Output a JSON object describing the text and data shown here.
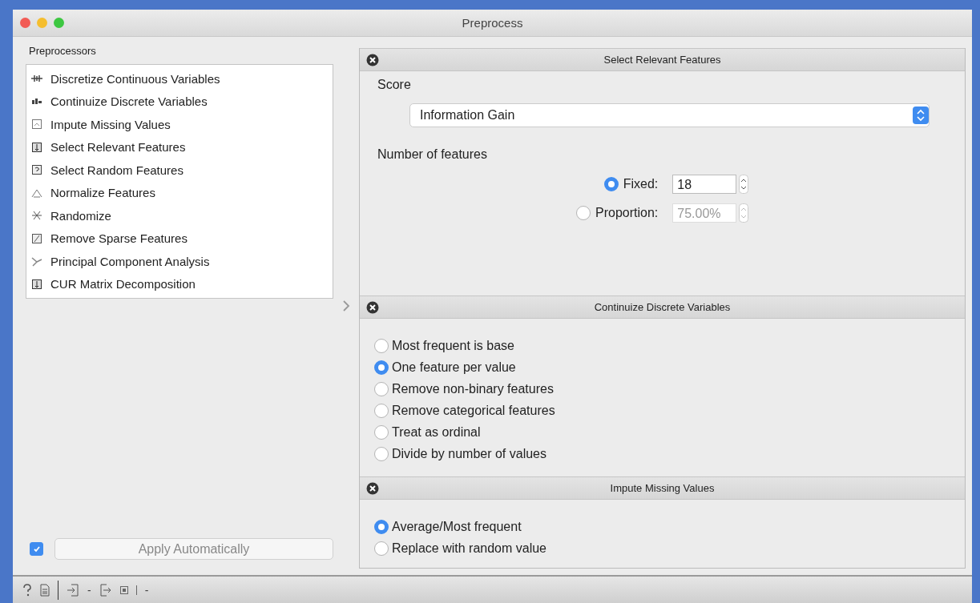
{
  "window": {
    "title": "Preprocess"
  },
  "sidebar": {
    "title": "Preprocessors",
    "items": [
      {
        "label": "Discretize Continuous Variables"
      },
      {
        "label": "Continuize Discrete Variables"
      },
      {
        "label": "Impute Missing Values"
      },
      {
        "label": "Select Relevant Features"
      },
      {
        "label": "Select Random Features"
      },
      {
        "label": "Normalize Features"
      },
      {
        "label": "Randomize"
      },
      {
        "label": "Remove Sparse Features"
      },
      {
        "label": "Principal Component Analysis"
      },
      {
        "label": "CUR Matrix Decomposition"
      }
    ]
  },
  "auto_apply": {
    "checked": true,
    "label": "Apply Automatically"
  },
  "sections": [
    {
      "kind": "features",
      "title": "Select Relevant Features",
      "score_label": "Score",
      "score_value": "Information Gain",
      "count_label": "Number of features",
      "options": [
        {
          "label": "Fixed:",
          "value": "18",
          "selected": true
        },
        {
          "label": "Proportion:",
          "value": "75.00%",
          "selected": false
        }
      ]
    },
    {
      "kind": "radios",
      "title": "Continuize Discrete Variables",
      "options": [
        {
          "label": "Most frequent is base",
          "selected": false
        },
        {
          "label": "One feature per value",
          "selected": true
        },
        {
          "label": "Remove non-binary features",
          "selected": false
        },
        {
          "label": "Remove categorical features",
          "selected": false
        },
        {
          "label": "Treat as ordinal",
          "selected": false
        },
        {
          "label": "Divide by number of values",
          "selected": false
        }
      ]
    },
    {
      "kind": "radios",
      "title": "Impute Missing Values",
      "options": [
        {
          "label": "Average/Most frequent",
          "selected": true
        },
        {
          "label": "Replace with random value",
          "selected": false
        }
      ]
    }
  ],
  "status_bar": {
    "input_label": "-",
    "output_label": "-"
  }
}
